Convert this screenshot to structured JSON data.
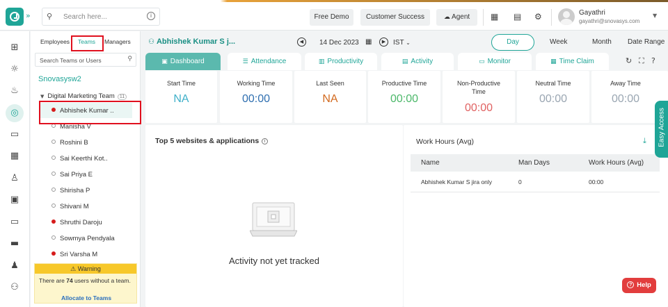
{
  "header": {
    "search_placeholder": "Search here...",
    "free_demo": "Free Demo",
    "customer_success": "Customer Success",
    "agent": "Agent",
    "user_name": "Gayathri",
    "user_email": "gayathri@snovasys.com"
  },
  "panel": {
    "tabs": [
      "Employees",
      "Teams",
      "Managers"
    ],
    "search_placeholder": "Search Teams or Users",
    "org": "Snovasysw2",
    "team": "Digital Marketing Team",
    "team_count": "11",
    "members": [
      {
        "name": "Abhishek Kumar ..",
        "status": "offline-red"
      },
      {
        "name": "Manisha V",
        "status": "empty"
      },
      {
        "name": "Roshini B",
        "status": "empty"
      },
      {
        "name": "Sai Keerthi Kot..",
        "status": "empty"
      },
      {
        "name": "Sai Priya E",
        "status": "empty"
      },
      {
        "name": "Shirisha P",
        "status": "empty"
      },
      {
        "name": "Shivani M",
        "status": "empty"
      },
      {
        "name": "Shruthi Daroju",
        "status": "offline-red"
      },
      {
        "name": "Sowmya Pendyala",
        "status": "empty"
      },
      {
        "name": "Sri Varsha M",
        "status": "offline-red"
      }
    ],
    "warning": {
      "title": "Warning",
      "text_pre": "There are ",
      "count": "74",
      "text_post": " users without a team.",
      "link": "Allocate to Teams"
    }
  },
  "main": {
    "employee": "Abhishek Kumar S j...",
    "date": "14 Dec 2023",
    "timezone": "IST",
    "periods": [
      "Day",
      "Week",
      "Month",
      "Date Range"
    ],
    "tabs": [
      "Dashboard",
      "Attendance",
      "Productivity",
      "Activity",
      "Monitor",
      "Time Claim"
    ],
    "stats": [
      {
        "label": "Start Time",
        "value": "NA",
        "color": "#3fb0c9"
      },
      {
        "label": "Working Time",
        "value": "00:00",
        "color": "#2f6fb0"
      },
      {
        "label": "Last Seen",
        "value": "NA",
        "color": "#d2691e"
      },
      {
        "label": "Productive Time",
        "value": "00:00",
        "color": "#4cb86a"
      },
      {
        "label": "Non-Productive Time",
        "value": "00:00",
        "color": "#e06262"
      },
      {
        "label": "Neutral Time",
        "value": "00:00",
        "color": "#9aa6b2"
      },
      {
        "label": "Away Time",
        "value": "00:00",
        "color": "#9aa6b2"
      }
    ],
    "top5_title": "Top 5 websites & applications",
    "empty_message": "Activity not yet tracked",
    "work_hours": {
      "title": "Work Hours (Avg)",
      "columns": [
        "Name",
        "Man Days",
        "Work Hours (Avg)"
      ],
      "rows": [
        [
          "Abhishek Kumar S jira only",
          "0",
          "00:00"
        ]
      ]
    }
  },
  "easy_access": "Easy Access",
  "help": "Help"
}
